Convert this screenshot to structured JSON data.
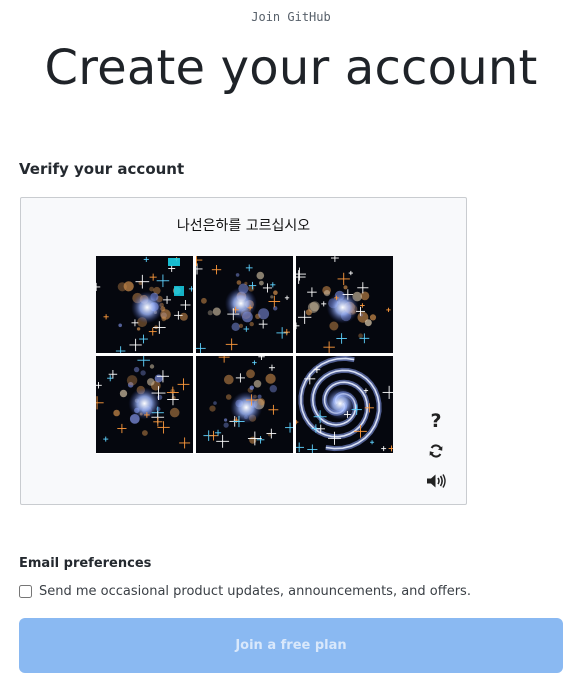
{
  "header": {
    "eyebrow": "Join GitHub",
    "title": "Create your account"
  },
  "verify": {
    "label": "Verify your account",
    "prompt": "나선은하를 고르십시오",
    "tiles": [
      {
        "name": "galaxy-image-1",
        "kind": "irregular"
      },
      {
        "name": "galaxy-image-2",
        "kind": "irregular"
      },
      {
        "name": "galaxy-image-3",
        "kind": "irregular"
      },
      {
        "name": "galaxy-image-4",
        "kind": "irregular"
      },
      {
        "name": "galaxy-image-5",
        "kind": "irregular"
      },
      {
        "name": "galaxy-image-6",
        "kind": "spiral"
      }
    ],
    "controls": {
      "help_label": "?",
      "help_icon": "question-mark-icon",
      "refresh_icon": "refresh-icon",
      "audio_icon": "speaker-icon"
    }
  },
  "email": {
    "label": "Email preferences",
    "checkbox_label": "Send me occasional product updates, announcements, and offers.",
    "checked": false
  },
  "submit": {
    "label": "Join a free plan"
  },
  "colors": {
    "button_bg": "#8ab9f2",
    "button_text": "#d9e8fb",
    "captcha_bg": "#f8f9fb",
    "tile_bg": "#05070e"
  }
}
